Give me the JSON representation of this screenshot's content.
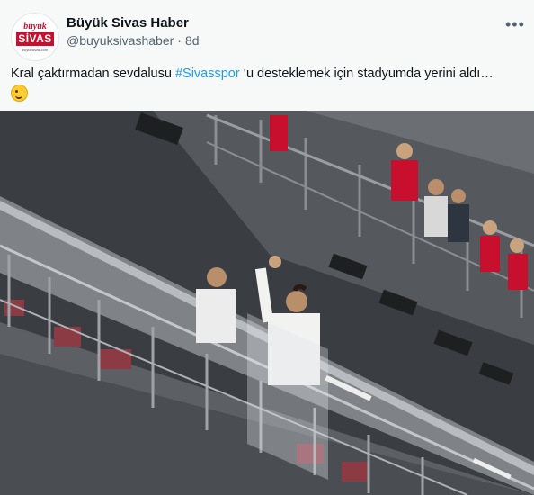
{
  "account": {
    "display_name": "Büyük Sivas Haber",
    "handle": "@buyuksivashaber",
    "separator": "·",
    "time": "8d",
    "avatar_logo": {
      "line1": "büyük",
      "line2": "SİVAS",
      "line3": "buyuksivas.com"
    }
  },
  "tweet": {
    "text_before": "Kral çaktırmadan sevdalusu ",
    "hashtag": "#Sivasspor",
    "text_after": " ‘u desteklemek için stadyumda yerini aldı…",
    "emoji": "winking-face-emoji"
  },
  "menu_icon": "more-horizontal-icon",
  "media": {
    "type": "photo",
    "description_icon": "stadium-balcony-photo"
  },
  "colors": {
    "link": "#1d9bf0",
    "secondary_text": "#536471",
    "background": "#f7f9f9",
    "brand_red": "#c8102e"
  }
}
